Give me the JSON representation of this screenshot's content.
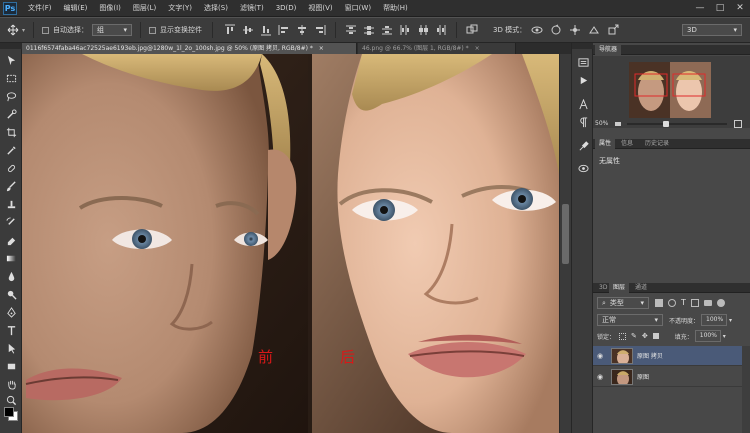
{
  "app": {
    "logo": "Ps"
  },
  "menu": [
    "文件(F)",
    "编辑(E)",
    "图像(I)",
    "图层(L)",
    "文字(Y)",
    "选择(S)",
    "滤镜(T)",
    "3D(D)",
    "视图(V)",
    "窗口(W)",
    "帮助(H)"
  ],
  "window_controls": {
    "minimize": "—",
    "maximize": "□",
    "close": "✕"
  },
  "options": {
    "auto_select_label": "自动选择：",
    "auto_select_value": "组",
    "show_transform_label": "显示变换控件",
    "mode_3d_label": "3D 模式：",
    "workspace_value": "3D"
  },
  "tabs": [
    {
      "label": "0116f6574faba46ac72525ae6193eb.jpg@1280w_1l_2o_100sh.jpg @ 50% (原图 拷贝, RGB/8#) *",
      "close": "×"
    },
    {
      "label": "46.png @ 66.7% (图层 1, RGB/8#) *",
      "close": "×"
    }
  ],
  "canvas": {
    "before_label": "前",
    "after_label": "后"
  },
  "navigator": {
    "tab": "导航器",
    "zoom": "50%"
  },
  "properties": {
    "tabs": [
      "属性",
      "信息",
      "历史记录"
    ],
    "content": "无属性"
  },
  "layers": {
    "tabs": [
      "3D",
      "图层",
      "通道"
    ],
    "filter_label": "类型",
    "blend_mode": "正常",
    "opacity_label": "不透明度：",
    "opacity_value": "100%",
    "lock_label": "锁定：",
    "fill_label": "填充：",
    "fill_value": "100%",
    "items": [
      {
        "name": "原图 拷贝",
        "selected": true
      },
      {
        "name": "原图",
        "selected": false
      }
    ]
  },
  "colors": {
    "accent_selected_layer": "#4a5a78",
    "menubar": "#2f2f2f",
    "panel": "#484848",
    "ps_blue": "#4db0ff"
  }
}
